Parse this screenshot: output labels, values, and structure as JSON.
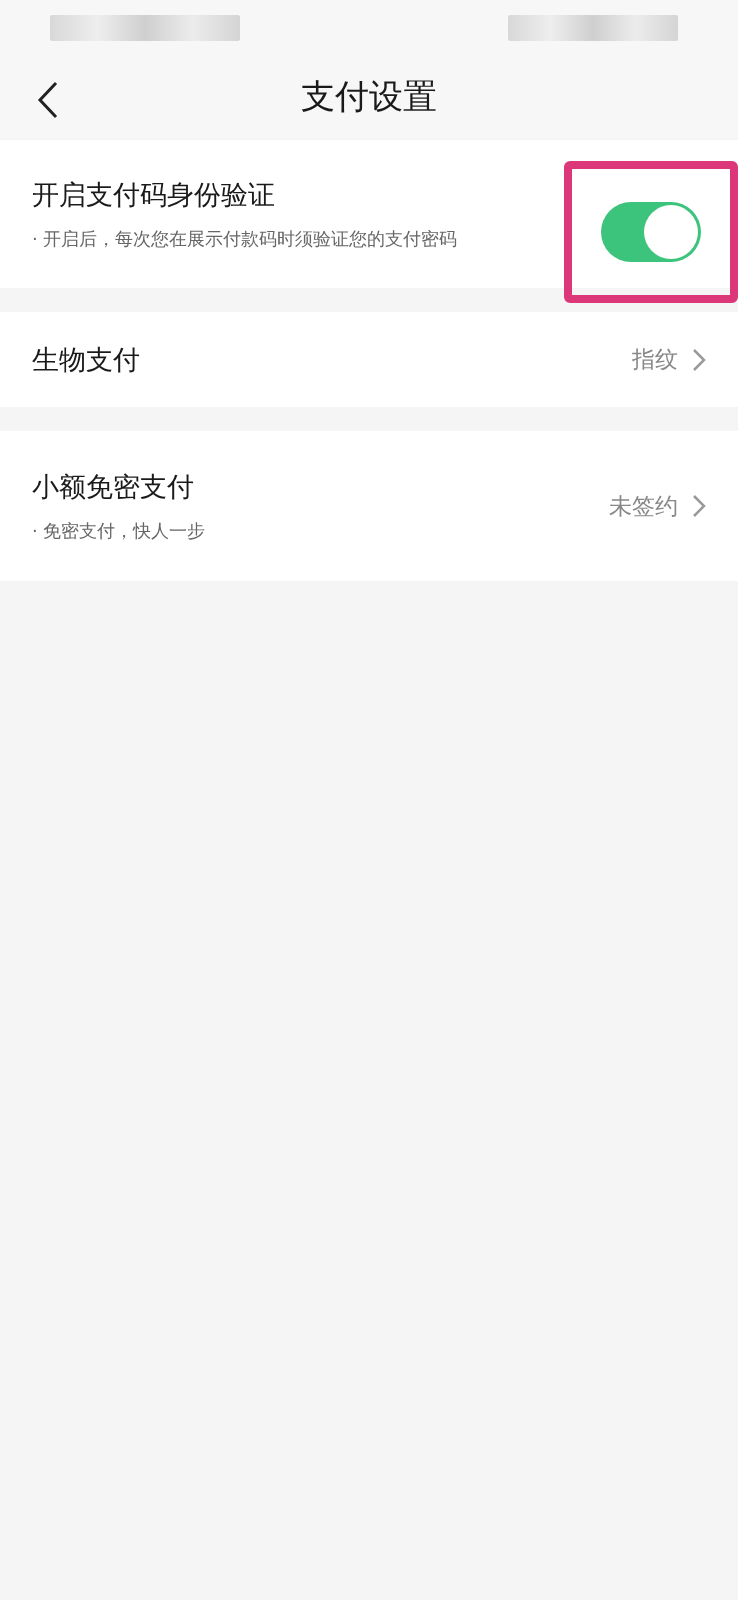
{
  "header": {
    "title": "支付设置"
  },
  "sections": [
    {
      "kind": "toggle",
      "title": "开启支付码身份验证",
      "subtitle": "· 开启后，每次您在展示付款码时须验证您的支付密码",
      "on": true,
      "highlighted": true
    },
    {
      "kind": "link",
      "title": "生物支付",
      "value": "指纹"
    },
    {
      "kind": "link",
      "title": "小额免密支付",
      "subtitle": "· 免密支付，快人一步",
      "value": "未签约"
    }
  ]
}
